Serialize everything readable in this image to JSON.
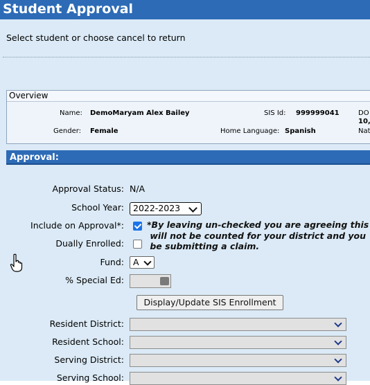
{
  "window": {
    "title": "Student Approval"
  },
  "instruction": "Select student or choose cancel to return",
  "overview": {
    "heading": "Overview",
    "name_label": "Name:",
    "name_value": "DemoMaryam Alex Bailey",
    "sis_label": "SIS Id:",
    "sis_value": "999999041",
    "dob_label_partial": "DO",
    "dob_value_partial": "10,",
    "gender_label": "Gender:",
    "gender_value": "Female",
    "language_label": "Home Language:",
    "language_value": "Spanish",
    "nat_label_partial": "Nat"
  },
  "approval": {
    "heading": "Approval:",
    "status_label": "Approval Status:",
    "status_value": "N/A",
    "year_label": "School Year:",
    "year_value": "2022-2023",
    "include_label": "Include on Approval*:",
    "include_checked": true,
    "note": "*By leaving un-checked you are agreeing this\n will not be counted for your district and you\n be submitting a claim.",
    "dual_label": "Dually Enrolled:",
    "dual_checked": false,
    "fund_label": "Fund:",
    "fund_value": "A",
    "sped_label": "% Special Ed:",
    "sped_value": "",
    "sis_button": "Display/Update SIS Enrollment",
    "resident_district_label": "Resident District:",
    "resident_school_label": "Resident School:",
    "serving_district_label": "Serving District:",
    "serving_school_label": "Serving School:"
  },
  "colors": {
    "header": "#2d6bb6",
    "panel": "#dbeaf6"
  },
  "icons": {
    "cursor": "hand-pointer-icon",
    "dropdown": "chevron-down-icon",
    "calculator": "calculator-icon"
  }
}
